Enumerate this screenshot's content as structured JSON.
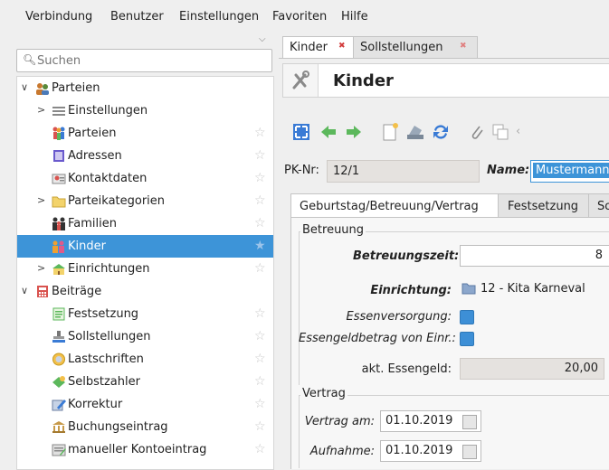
{
  "menu": [
    "Verbindung",
    "Benutzer",
    "Einstellungen",
    "Favoriten",
    "Hilfe"
  ],
  "search": {
    "placeholder": "Suchen"
  },
  "tree": [
    {
      "label": "Parteien"
    },
    {
      "label": "Einstellungen"
    },
    {
      "label": "Parteien"
    },
    {
      "label": "Adressen"
    },
    {
      "label": "Kontaktdaten"
    },
    {
      "label": "Parteikategorien"
    },
    {
      "label": "Familien"
    },
    {
      "label": "Kinder"
    },
    {
      "label": "Einrichtungen"
    },
    {
      "label": "Beiträge"
    },
    {
      "label": "Festsetzung"
    },
    {
      "label": "Sollstellungen"
    },
    {
      "label": "Lastschriften"
    },
    {
      "label": "Selbstzahler"
    },
    {
      "label": "Korrektur"
    },
    {
      "label": "Buchungseintrag"
    },
    {
      "label": "manueller Kontoeintrag"
    }
  ],
  "tabs": [
    "Kinder",
    "Sollstellungen"
  ],
  "form": {
    "title": "Kinder",
    "pk_label": "PK-Nr:",
    "pk_value": "12/1",
    "name_label": "Name:",
    "name_value": "Mustermann",
    "inner_tabs": [
      "Geburtstag/Betreuung/Vertrag",
      "Festsetzung",
      "So"
    ],
    "betreuung": {
      "legend": "Betreuung",
      "zeit_label": "Betreuungszeit:",
      "zeit_value": "8",
      "einr_label": "Einrichtung:",
      "einr_value": "12 - Kita Karneval",
      "essen_label": "Essenversorgung:",
      "essengeld_label": "Essengeldbetrag von Einr.:",
      "akt_label": "akt. Essengeld:",
      "akt_value": "20,00"
    },
    "vertrag": {
      "legend": "Vertrag",
      "am_label": "Vertrag am:",
      "am_value": "01.10.2019",
      "aufn_label": "Aufnahme:",
      "aufn_value": "01.10.2019"
    }
  }
}
